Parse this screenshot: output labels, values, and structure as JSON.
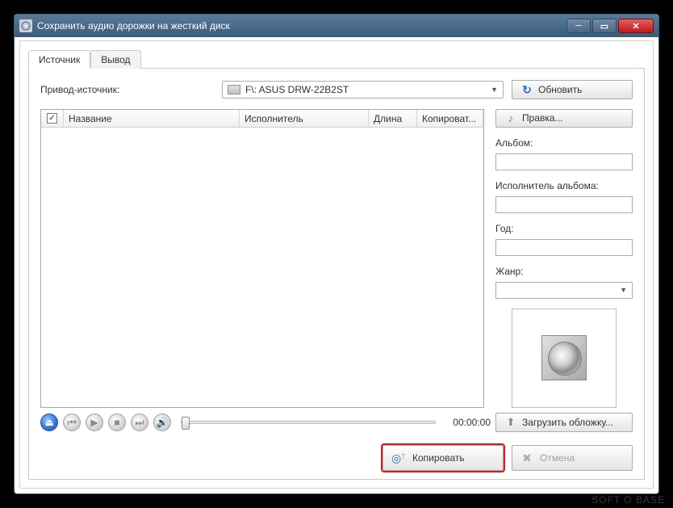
{
  "window": {
    "title": "Сохранить аудио дорожки на жесткий диск"
  },
  "tabs": {
    "source": "Источник",
    "output": "Вывод"
  },
  "source_drive_label": "Привод-источник:",
  "drive_value": "F\\: ASUS    DRW-22B2ST",
  "buttons": {
    "refresh": "Обновить",
    "edit": "Правка...",
    "load_cover": "Загрузить обложку...",
    "copy": "Копировать",
    "cancel": "Отмена"
  },
  "columns": {
    "name": "Название",
    "artist": "Исполнитель",
    "length": "Длина",
    "copy": "Копироват..."
  },
  "fields": {
    "album": "Альбом:",
    "album_artist": "Исполнитель альбома:",
    "year": "Год:",
    "genre": "Жанр:"
  },
  "values": {
    "album": "",
    "album_artist": "",
    "year": "",
    "genre": ""
  },
  "playback_time": "00:00:00",
  "watermark": "SOFT O BASE"
}
